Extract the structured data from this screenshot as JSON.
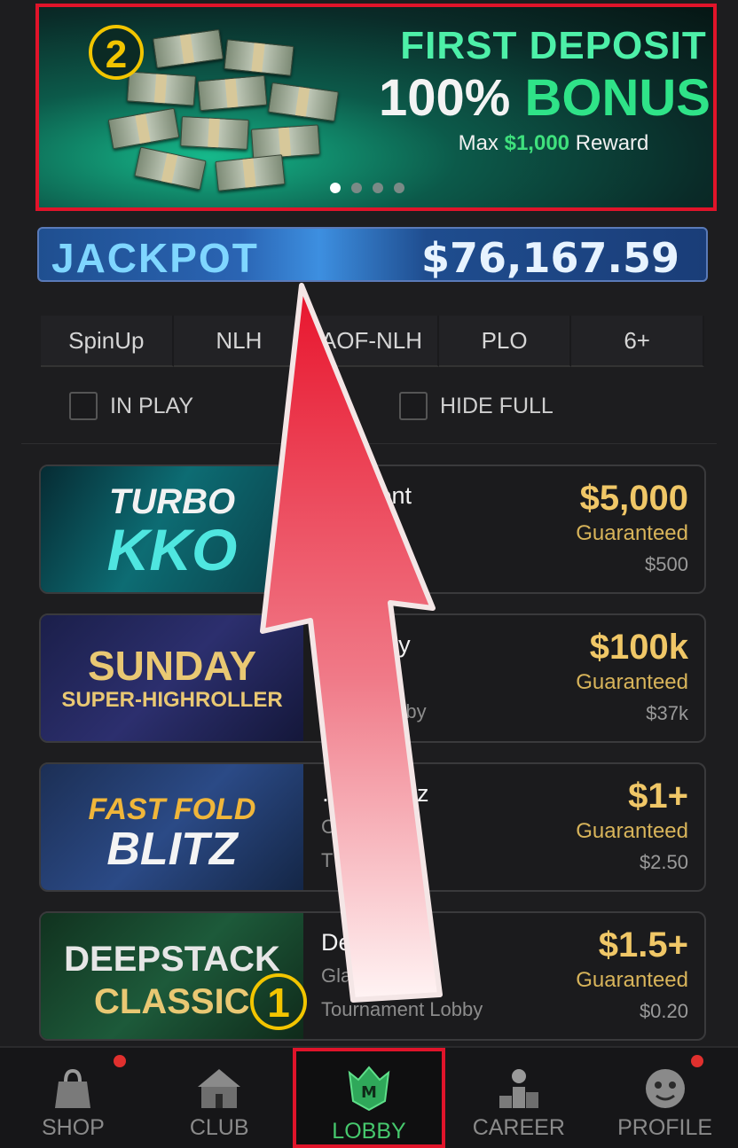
{
  "banner": {
    "step_number": "2",
    "title": "FIRST DEPOSIT",
    "bonus_white": "100%",
    "bonus_green": "BONUS",
    "sub_prefix": "Max",
    "sub_amount": "$1,000",
    "sub_suffix": "Reward",
    "dots_total": 4,
    "dots_active": 1
  },
  "jackpot": {
    "label": "JACKPOT",
    "amount": "$76,167.59"
  },
  "tabs": [
    "SpinUp",
    "NLH",
    "AOF-NLH",
    "PLO",
    "6+"
  ],
  "filters": {
    "in_play": "IN PLAY",
    "hide_full": "HIDE FULL"
  },
  "cards": [
    {
      "thumb_line1": "TURBO",
      "thumb_line2": "KKO",
      "name": "…ament",
      "sub": "",
      "lobby": "…nt Lobby",
      "prize": "$5,000",
      "guaranteed": "Guaranteed",
      "buyin": "$500"
    },
    {
      "thumb_line1": "SUNDAY",
      "thumb_line2": "SUPER-HIGHROLLER",
      "name": "…unday",
      "sub": "…e",
      "lobby": "…ent Lobby",
      "prize": "$100k",
      "guaranteed": "Guaranteed",
      "buyin": "$37k"
    },
    {
      "thumb_line1": "FAST FOLD",
      "thumb_line2": "BLITZ",
      "name": "…old Blitz",
      "sub": "C…",
      "lobby": "T…t Lobby",
      "prize": "$1+",
      "guaranteed": "Guaranteed",
      "buyin": "$2.50"
    },
    {
      "thumb_line1": "DEEPSTACK",
      "thumb_line2": "CLASSIC",
      "name": "De…ck",
      "sub": "Gla…",
      "lobby": "Tournament Lobby",
      "prize": "$1.5+",
      "guaranteed": "Guaranteed",
      "buyin": "$0.20"
    }
  ],
  "step_one": "1",
  "nav": [
    {
      "label": "SHOP",
      "icon": "shop-bag-icon"
    },
    {
      "label": "CLUB",
      "icon": "club-tent-icon"
    },
    {
      "label": "LOBBY",
      "icon": "lobby-crown-logo-icon"
    },
    {
      "label": "CAREER",
      "icon": "career-trophy-icon"
    },
    {
      "label": "PROFILE",
      "icon": "profile-avatar-icon"
    }
  ],
  "colors": {
    "highlight_red": "#e0142a",
    "gold": "#f0c767",
    "lobby_green": "#46c86d",
    "annotation_yellow": "#f2c500"
  }
}
